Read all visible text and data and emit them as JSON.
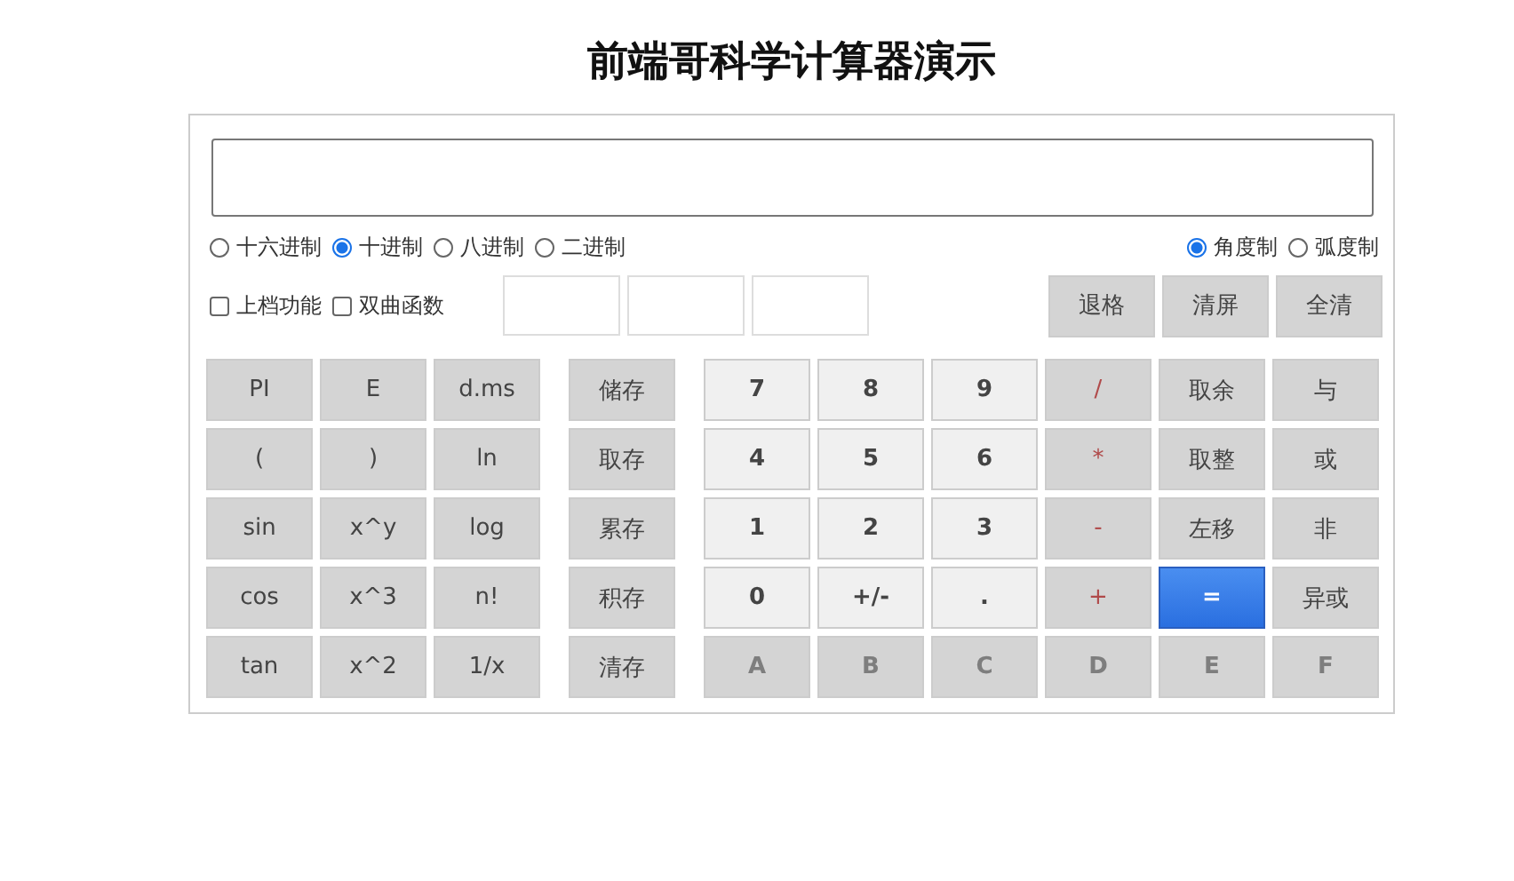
{
  "title": "前端哥科学计算器演示",
  "bases": [
    {
      "label": "十六进制",
      "selected": false
    },
    {
      "label": "十进制",
      "selected": true
    },
    {
      "label": "八进制",
      "selected": false
    },
    {
      "label": "二进制",
      "selected": false
    }
  ],
  "angle_units": [
    {
      "label": "角度制",
      "selected": true
    },
    {
      "label": "弧度制",
      "selected": false
    }
  ],
  "options": [
    {
      "label": "上档功能",
      "checked": false
    },
    {
      "label": "双曲函数",
      "checked": false
    }
  ],
  "edit_buttons": [
    "退格",
    "清屏",
    "全清"
  ],
  "function_keys": [
    [
      "PI",
      "E",
      "d.ms"
    ],
    [
      "(",
      ")",
      "ln"
    ],
    [
      "sin",
      "x^y",
      "log"
    ],
    [
      "cos",
      "x^3",
      "n!"
    ],
    [
      "tan",
      "x^2",
      "1/x"
    ]
  ],
  "memory_keys": [
    "储存",
    "取存",
    "累存",
    "积存",
    "清存"
  ],
  "main_keys": [
    [
      {
        "label": "7",
        "kind": "digit",
        "disabled": false
      },
      {
        "label": "8",
        "kind": "digit",
        "disabled": false
      },
      {
        "label": "9",
        "kind": "digit",
        "disabled": false
      },
      {
        "label": "/",
        "kind": "operator",
        "disabled": false
      },
      {
        "label": "取余",
        "kind": "function",
        "disabled": false
      },
      {
        "label": "与",
        "kind": "function",
        "disabled": false
      }
    ],
    [
      {
        "label": "4",
        "kind": "digit",
        "disabled": false
      },
      {
        "label": "5",
        "kind": "digit",
        "disabled": false
      },
      {
        "label": "6",
        "kind": "digit",
        "disabled": false
      },
      {
        "label": "*",
        "kind": "operator",
        "disabled": false
      },
      {
        "label": "取整",
        "kind": "function",
        "disabled": false
      },
      {
        "label": "或",
        "kind": "function",
        "disabled": false
      }
    ],
    [
      {
        "label": "1",
        "kind": "digit",
        "disabled": false
      },
      {
        "label": "2",
        "kind": "digit",
        "disabled": false
      },
      {
        "label": "3",
        "kind": "digit",
        "disabled": false
      },
      {
        "label": "-",
        "kind": "operator",
        "disabled": false
      },
      {
        "label": "左移",
        "kind": "function",
        "disabled": false
      },
      {
        "label": "非",
        "kind": "function",
        "disabled": false
      }
    ],
    [
      {
        "label": "0",
        "kind": "digit",
        "disabled": false
      },
      {
        "label": "+/-",
        "kind": "digit",
        "disabled": false
      },
      {
        "label": ".",
        "kind": "digit",
        "disabled": false
      },
      {
        "label": "+",
        "kind": "operator",
        "disabled": false
      },
      {
        "label": "=",
        "kind": "equals",
        "disabled": false
      },
      {
        "label": "异或",
        "kind": "function",
        "disabled": false
      }
    ],
    [
      {
        "label": "A",
        "kind": "digit",
        "disabled": true
      },
      {
        "label": "B",
        "kind": "digit",
        "disabled": true
      },
      {
        "label": "C",
        "kind": "digit",
        "disabled": true
      },
      {
        "label": "D",
        "kind": "digit",
        "disabled": true
      },
      {
        "label": "E",
        "kind": "digit",
        "disabled": true
      },
      {
        "label": "F",
        "kind": "digit",
        "disabled": true
      }
    ]
  ]
}
